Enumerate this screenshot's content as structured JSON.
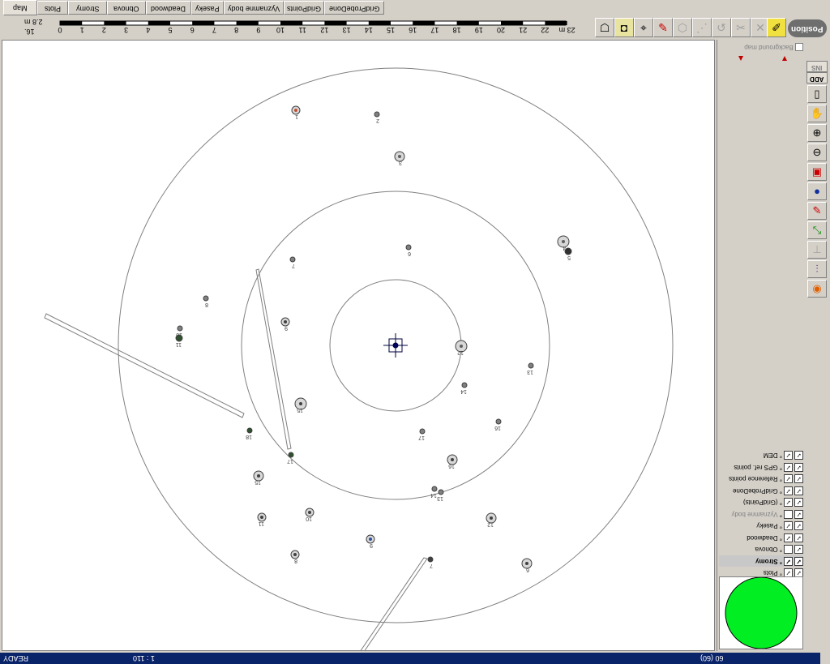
{
  "tabs": [
    "Map",
    "Plots",
    "Stromy",
    "Obnova",
    "Deadwood",
    "Paseky",
    "Vyznamne body",
    "GridPoints",
    "GridProbeDone"
  ],
  "scale": {
    "label": "2.8 m",
    "value": "16.",
    "ticks": [
      "0",
      "1",
      "2",
      "3",
      "4",
      "5",
      "6",
      "7",
      "8",
      "9",
      "10",
      "11",
      "12",
      "13",
      "14",
      "15",
      "16",
      "17",
      "18",
      "19",
      "20",
      "21",
      "22",
      "23 m"
    ]
  },
  "toolbar": {
    "icons": [
      "person-tool-icon",
      "camera-tool-icon",
      "target-tool-icon",
      "marker-tool-icon",
      "polygon-tool-icon",
      "node-tool-icon",
      "path-tool-icon",
      "cut-tool-icon",
      "delete-tool-icon",
      "pencil-tool-icon"
    ],
    "position_label": "Position"
  },
  "panel": {
    "background_map": "Background map",
    "tab_ins": "INS",
    "tab_add": "ADD",
    "layers": [
      {
        "name": "DEM",
        "checked": true
      },
      {
        "name": "GPS ref. points",
        "checked": true
      },
      {
        "name": "Reference points",
        "checked": true
      },
      {
        "name": "GridProbeDone",
        "checked": true
      },
      {
        "name": "(GridPoints)",
        "checked": true
      },
      {
        "name": "Vyznamne body",
        "checked": false
      },
      {
        "name": "Paseky",
        "checked": true
      },
      {
        "name": "Deadwood",
        "checked": true
      },
      {
        "name": "Obnova",
        "checked": false
      },
      {
        "name": "Stromy",
        "checked": true,
        "selected": true
      },
      {
        "name": "Plots",
        "checked": true
      }
    ],
    "preview_color": "#00ee22"
  },
  "right_tools": [
    "select-tool-icon",
    "hand-tool-icon",
    "zoom-in-icon",
    "zoom-out-icon",
    "zoom-extent-icon",
    "globe-icon",
    "measure-tool-icon",
    "resize-tool-icon",
    "disabled-tool-icon",
    "dimension-tool-icon",
    "fire-tool-icon"
  ],
  "map": {
    "labels": [
      "1",
      "2",
      "3",
      "4",
      "5",
      "6",
      "7",
      "8",
      "9",
      "10",
      "11",
      "12",
      "13",
      "14",
      "15",
      "16",
      "17",
      "18"
    ]
  },
  "status": {
    "state": "READY",
    "scale": "1 : 110",
    "count": "60 (60)"
  }
}
